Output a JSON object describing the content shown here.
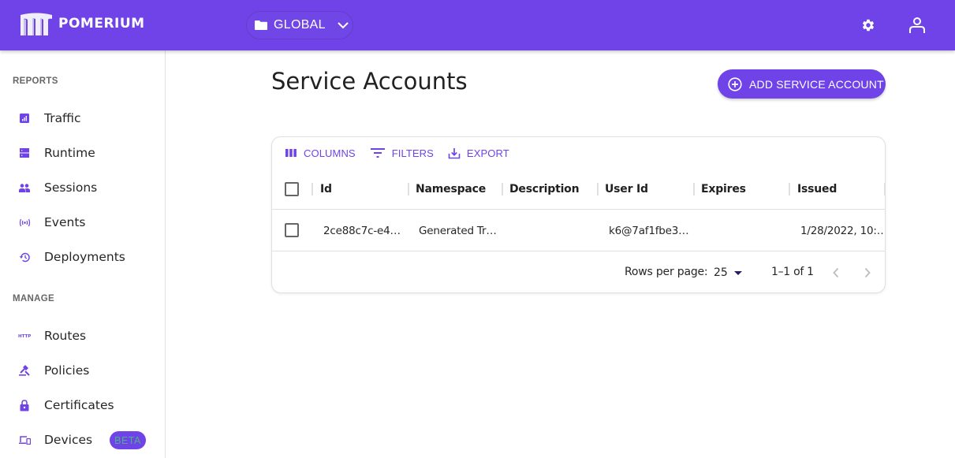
{
  "app": {
    "brand": "POMERIUM",
    "namespace_selector": "GLOBAL",
    "colors": {
      "primary": "#6f43e7",
      "beta_text": "#4caf8a"
    }
  },
  "topbar": {
    "icons": [
      "gear-icon",
      "account-icon"
    ]
  },
  "sidebar": {
    "sections": [
      {
        "title": "REPORTS",
        "items": [
          {
            "label": "Traffic",
            "icon": "bar-chart-icon"
          },
          {
            "label": "Runtime",
            "icon": "server-icon"
          },
          {
            "label": "Sessions",
            "icon": "people-icon"
          },
          {
            "label": "Events",
            "icon": "broadcast-icon"
          },
          {
            "label": "Deployments",
            "icon": "history-icon"
          }
        ]
      },
      {
        "title": "MANAGE",
        "items": [
          {
            "label": "Routes",
            "icon": "http-icon"
          },
          {
            "label": "Policies",
            "icon": "gavel-icon"
          },
          {
            "label": "Certificates",
            "icon": "lock-icon"
          },
          {
            "label": "Devices",
            "icon": "devices-icon",
            "badge": "BETA"
          }
        ]
      }
    ]
  },
  "main": {
    "title": "Service Accounts",
    "add_button": "ADD SERVICE ACCOUNT",
    "toolbar": {
      "columns": "COLUMNS",
      "filters": "FILTERS",
      "export": "EXPORT"
    },
    "table": {
      "columns": [
        "Id",
        "Namespace",
        "Description",
        "User Id",
        "Expires",
        "Issued"
      ],
      "rows": [
        {
          "id": "2ce88c7c-e4…",
          "namespace": "Generated Tr…",
          "description": "",
          "user_id": "k6@7af1fbe3…",
          "expires": "",
          "issued": "1/28/2022, 10:…"
        }
      ]
    },
    "pagination": {
      "rows_per_page_label": "Rows per page:",
      "rows_per_page": "25",
      "range": "1–1 of 1"
    }
  }
}
